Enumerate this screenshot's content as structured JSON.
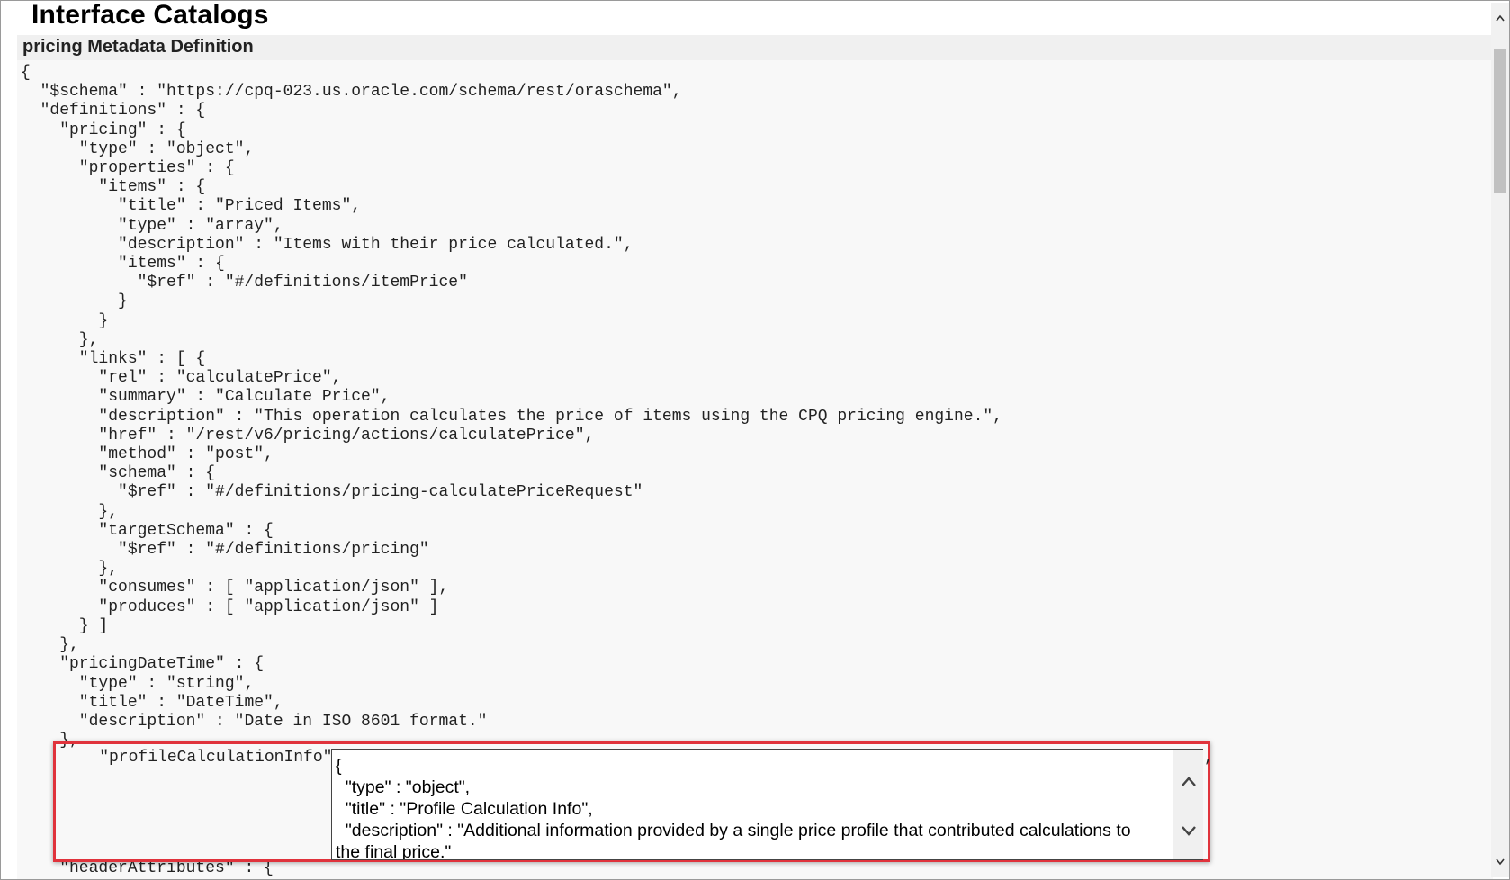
{
  "page": {
    "title": "Interface Catalogs",
    "subtitle": "pricing Metadata Definition"
  },
  "code": {
    "text": "{\n  \"$schema\" : \"https://cpq-023.us.oracle.com/schema/rest/oraschema\",\n  \"definitions\" : {\n    \"pricing\" : {\n      \"type\" : \"object\",\n      \"properties\" : {\n        \"items\" : {\n          \"title\" : \"Priced Items\",\n          \"type\" : \"array\",\n          \"description\" : \"Items with their price calculated.\",\n          \"items\" : {\n            \"$ref\" : \"#/definitions/itemPrice\"\n          }\n        }\n      },\n      \"links\" : [ {\n        \"rel\" : \"calculatePrice\",\n        \"summary\" : \"Calculate Price\",\n        \"description\" : \"This operation calculates the price of items using the CPQ pricing engine.\",\n        \"href\" : \"/rest/v6/pricing/actions/calculatePrice\",\n        \"method\" : \"post\",\n        \"schema\" : {\n          \"$ref\" : \"#/definitions/pricing-calculatePriceRequest\"\n        },\n        \"targetSchema\" : {\n          \"$ref\" : \"#/definitions/pricing\"\n        },\n        \"consumes\" : [ \"application/json\" ],\n        \"produces\" : [ \"application/json\" ]\n      } ]\n    },\n    \"pricingDateTime\" : {\n      \"type\" : \"string\",\n      \"title\" : \"DateTime\",\n      \"description\" : \"Date in ISO 8601 format.\"\n    },",
    "highlight_key": "    \"profileCalculationInfo\" :",
    "textarea_value": "{\n  \"type\" : \"object\",\n  \"title\" : \"Profile Calculation Info\",\n  \"description\" : \"Additional information provided by a single price profile that contributed calculations to the final price.\"",
    "trailing_comma": ",",
    "next_line": "    \"headerAttributes\" : {"
  },
  "colors": {
    "highlight_border": "#e0333c",
    "code_background": "#f8f8f8"
  },
  "icons": {
    "textarea_up": "chevron-up-icon",
    "textarea_down": "chevron-down-icon",
    "page_scroll_up": "scroll-up-arrow-icon",
    "page_scroll_down": "scroll-down-arrow-icon"
  }
}
